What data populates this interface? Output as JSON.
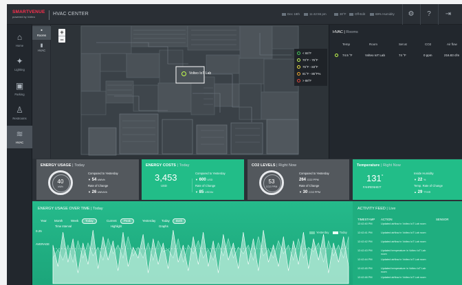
{
  "header": {
    "brand": "SMARTVENUE",
    "powered": "powered by Volteo",
    "title": "HVAC CENTER",
    "date": "Dec 18th",
    "time": "11:42:55 pm",
    "temperature": "30°F",
    "mode": "Off-Edit",
    "humidity": "69% Humidity"
  },
  "sidebar": {
    "items": [
      {
        "label": "Home",
        "icon": "home-icon"
      },
      {
        "label": "Lighting",
        "icon": "lighting-icon"
      },
      {
        "label": "Parking",
        "icon": "parking-icon"
      },
      {
        "label": "Restrooms",
        "icon": "restrooms-icon"
      },
      {
        "label": "HVAC",
        "icon": "hvac-icon",
        "active": true
      }
    ]
  },
  "subnav": {
    "items": [
      {
        "label": "Rooms",
        "active": true
      },
      {
        "label": "HVAC",
        "active": false
      }
    ]
  },
  "map": {
    "room_label": "Volteo IoT Lab",
    "legend": [
      {
        "label": "< 65°F",
        "color": "#46c95d"
      },
      {
        "label": "70°F - 75°F",
        "color": "#c6f75c"
      },
      {
        "label": "76°F - 83°F",
        "color": "#f2e345"
      },
      {
        "label": "81°F - 85°F%",
        "color": "#f0a92f"
      },
      {
        "label": "> 88°F",
        "color": "#e5483d"
      }
    ]
  },
  "hvac_table": {
    "title": "HVAC",
    "subtitle": "Rooms",
    "columns": [
      "Temp",
      "Room",
      "Set at",
      "CO2",
      "Air flow"
    ],
    "rows": [
      {
        "temp": "74.5 °F",
        "room": "Volteo IoT Lab",
        "set_at": "74 °F",
        "co2": "0 ppm",
        "air_flow": "216.83 cfm"
      }
    ]
  },
  "cards": {
    "energy_usage": {
      "title": "ENERGY USAGE",
      "period": "Today",
      "gauge_value": "40",
      "gauge_unit": "kWh",
      "compared_label": "Compared to Yesterday",
      "compared_value": "54",
      "compared_unit": "kWh/h",
      "rate_label": "Rate of Change",
      "rate_value": "26",
      "rate_unit": "kWh/h/h"
    },
    "energy_costs": {
      "title": "ENERGY COSTS",
      "period": "Today",
      "value": "3,453",
      "unit": "USD",
      "compared_label": "Compared to Yesterday",
      "compared_value": "600",
      "compared_unit": "USD",
      "rate_label": "Rate of Change",
      "rate_value": "85",
      "rate_unit": "USD/hr"
    },
    "co2_levels": {
      "title": "CO2 LEVELS",
      "period": "Right Now",
      "gauge_value": "53",
      "gauge_unit": "CO2 PPM",
      "compared_label": "Compared to Yesterday",
      "compared_value": "264",
      "compared_unit": "CO2 PPM",
      "rate_label": "Rate of Change",
      "rate_value": "30",
      "rate_unit": "CO2 PPM"
    },
    "temperature": {
      "title": "Temperature",
      "period": "Right Now",
      "value": "131",
      "degree": "°",
      "unit": "FAHRENHEIT",
      "humidity_label": "Inside Humidity",
      "humidity_value": "22",
      "humidity_unit": "%",
      "temp_rate_label": "Temp. Rate of Change",
      "temp_rate_value": "29",
      "temp_rate_unit": "°F/HR"
    }
  },
  "energy_chart": {
    "title": "ENERGY USAGE OVER TIME",
    "period": "Today",
    "time_interval": {
      "label": "Time Interval",
      "options": [
        "Year",
        "Month",
        "Week",
        "Today"
      ],
      "selected": "Today"
    },
    "highlight": {
      "label": "Highlight",
      "options": [
        "Current",
        "Peak"
      ],
      "selected": "Peak"
    },
    "graphs": {
      "label": "Graphs",
      "options": [
        "Yesterday",
        "Today",
        "Both"
      ],
      "selected": "Both"
    },
    "legend": [
      "Yesterday",
      "Today"
    ],
    "y_tick": "0.25",
    "average_label": "AVERAGE"
  },
  "activity_feed": {
    "title": "ACTIVITY FEED",
    "subtitle": "Live",
    "columns": [
      "TIMESTAMP",
      "ACTION",
      "SENSOR"
    ],
    "rows": [
      {
        "timestamp": "12:42:40 PM",
        "action": "Updated airflow in Volteo IoT Lab room"
      },
      {
        "timestamp": "12:42:41 PM",
        "action": "Updated airflow in Volteo IoT Lab room"
      },
      {
        "timestamp": "12:42:42 PM",
        "action": "Updated airflow in Volteo IoT Lab room"
      },
      {
        "timestamp": "12:42:43 PM",
        "action": "Updated temperature in Volteo IoT Lab room"
      },
      {
        "timestamp": "12:42:44 PM",
        "action": "Updated airflow in Volteo IoT Lab room"
      },
      {
        "timestamp": "12:42:45 PM",
        "action": "Updated temperature in Volteo IoT Lab room"
      },
      {
        "timestamp": "12:42:46 PM",
        "action": "Updated airflow in Volteo IoT Lab room"
      }
    ]
  },
  "chart_data": {
    "type": "area",
    "title": "ENERGY USAGE OVER TIME",
    "xlabel": "",
    "ylabel": "",
    "series": [
      {
        "name": "Yesterday",
        "values": [
          0.12,
          0.16,
          0.11,
          0.18,
          0.1,
          0.2,
          0.12,
          0.19,
          0.13,
          0.17,
          0.11,
          0.21,
          0.14,
          0.18,
          0.12,
          0.22,
          0.13,
          0.17,
          0.12,
          0.19,
          0.11,
          0.2,
          0.15,
          0.16,
          0.12,
          0.21,
          0.1,
          0.18,
          0.14,
          0.2,
          0.12,
          0.16,
          0.11,
          0.19,
          0.13,
          0.21,
          0.12,
          0.17,
          0.14,
          0.18,
          0.11,
          0.22,
          0.13,
          0.16,
          0.12,
          0.2,
          0.14,
          0.18,
          0.11,
          0.21,
          0.12,
          0.17,
          0.15,
          0.19,
          0.1,
          0.2,
          0.13,
          0.18,
          0.12,
          0.22
        ]
      },
      {
        "name": "Today",
        "values": [
          0.18,
          0.08,
          0.24,
          0.1,
          0.21,
          0.05,
          0.19,
          0.09,
          0.25,
          0.07,
          0.22,
          0.11,
          0.2,
          0.06,
          0.24,
          0.08,
          0.17,
          0.12,
          0.23,
          0.05,
          0.21,
          0.09,
          0.19,
          0.07,
          0.25,
          0.1,
          0.18,
          0.06,
          0.22,
          0.09,
          0.24,
          0.08,
          0.2,
          0.05,
          0.23,
          0.11,
          0.19,
          0.07,
          0.24,
          0.09,
          0.21,
          0.06,
          0.25,
          0.1,
          0.18,
          0.08,
          0.22,
          0.06,
          0.2,
          0.09,
          0.24,
          0.07,
          0.21,
          0.11,
          0.23,
          0.05,
          0.19,
          0.1,
          0.22,
          0.08
        ]
      }
    ],
    "ylim": [
      0,
      0.25
    ],
    "grid": false,
    "legend": "top-right"
  }
}
